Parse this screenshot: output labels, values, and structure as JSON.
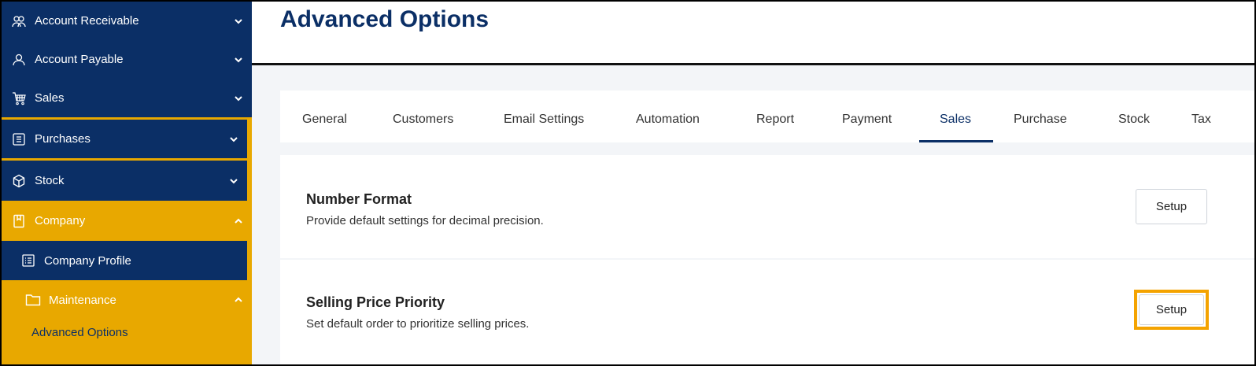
{
  "sidebar": {
    "items": [
      {
        "label": "Account Receivable",
        "icon": "users-icon"
      },
      {
        "label": "Account Payable",
        "icon": "user-icon"
      },
      {
        "label": "Sales",
        "icon": "cart-icon"
      },
      {
        "label": "Purchases",
        "icon": "receipt-icon"
      },
      {
        "label": "Stock",
        "icon": "box-icon"
      },
      {
        "label": "Company",
        "icon": "bookmark-icon"
      },
      {
        "label": "Company Profile",
        "icon": "profile-list-icon"
      },
      {
        "label": "Maintenance",
        "icon": "folder-icon"
      }
    ],
    "sub_link": "Advanced Options"
  },
  "header": {
    "title": "Advanced Options"
  },
  "tabs": [
    "General",
    "Customers",
    "Email Settings",
    "Automation",
    "Report",
    "Payment",
    "Sales",
    "Purchase",
    "Stock",
    "Tax"
  ],
  "active_tab": "Sales",
  "cards": [
    {
      "title": "Number Format",
      "description": "Provide default settings for decimal precision.",
      "button": "Setup"
    },
    {
      "title": "Selling Price Priority",
      "description": "Set default order to prioritize selling prices.",
      "button": "Setup"
    }
  ],
  "colors": {
    "navy": "#0b2f66",
    "gold": "#e8a800",
    "highlight": "#f4a300"
  }
}
